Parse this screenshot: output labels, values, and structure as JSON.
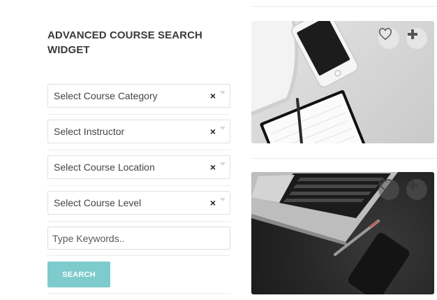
{
  "widget": {
    "title": "ADVANCED COURSE SEARCH WIDGET",
    "selects": [
      {
        "value": "Select Course Category",
        "clear": "×"
      },
      {
        "value": "Select Instructor",
        "clear": "×"
      },
      {
        "value": "Select Course Location",
        "clear": "×"
      },
      {
        "value": "Select Course Level",
        "clear": "×"
      }
    ],
    "keywords": {
      "placeholder": "Type Keywords.."
    },
    "search_label": "SEARCH"
  },
  "cards": [
    {
      "image": "phone-notebook-photo",
      "actions": [
        "heart-icon",
        "plus-icon"
      ]
    },
    {
      "image": "laptop-pen-photo",
      "actions": [
        "heart-icon",
        "plus-icon"
      ]
    }
  ],
  "colors": {
    "accent": "#7ecbcd",
    "title": "#3a3a3a"
  }
}
